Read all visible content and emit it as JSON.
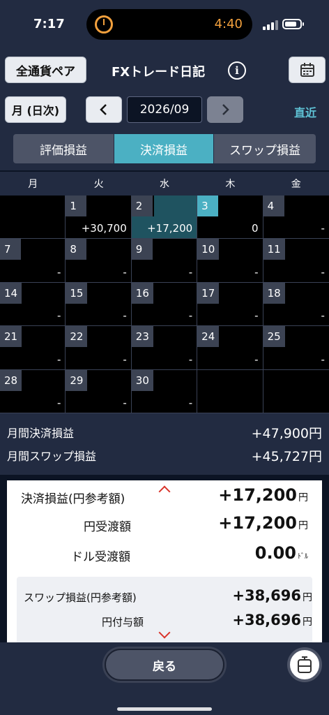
{
  "status_bar": {
    "time": "7:17",
    "timer": "4:40"
  },
  "header": {
    "pair_button": "全通貨ペア",
    "title": "FXトレード日記",
    "info_icon": "info-icon",
    "calendar_icon": "calendar-icon"
  },
  "date_nav": {
    "mode_button": "月 (日次)",
    "prev": "‹",
    "current": "2026/09",
    "next": "›",
    "recent": "直近"
  },
  "tabs": [
    {
      "label": "評価損益",
      "active": false
    },
    {
      "label": "決済損益",
      "active": true
    },
    {
      "label": "スワップ損益",
      "active": false
    }
  ],
  "calendar": {
    "weekdays": [
      "月",
      "火",
      "水",
      "木",
      "金"
    ],
    "cells": [
      {
        "day": "",
        "value": ""
      },
      {
        "day": "1",
        "value": "+30,700"
      },
      {
        "day": "2",
        "value": "+17,200",
        "selected": true
      },
      {
        "day": "3",
        "value": "0",
        "today": true
      },
      {
        "day": "4",
        "value": "-"
      },
      {
        "day": "7",
        "value": "-"
      },
      {
        "day": "8",
        "value": "-"
      },
      {
        "day": "9",
        "value": "-"
      },
      {
        "day": "10",
        "value": "-"
      },
      {
        "day": "11",
        "value": "-"
      },
      {
        "day": "14",
        "value": "-"
      },
      {
        "day": "15",
        "value": "-"
      },
      {
        "day": "16",
        "value": "-"
      },
      {
        "day": "17",
        "value": "-"
      },
      {
        "day": "18",
        "value": "-"
      },
      {
        "day": "21",
        "value": "-"
      },
      {
        "day": "22",
        "value": "-"
      },
      {
        "day": "23",
        "value": "-"
      },
      {
        "day": "24",
        "value": "-"
      },
      {
        "day": "25",
        "value": "-"
      },
      {
        "day": "28",
        "value": "-"
      },
      {
        "day": "29",
        "value": "-"
      },
      {
        "day": "30",
        "value": "-"
      },
      {
        "day": "",
        "value": ""
      },
      {
        "day": "",
        "value": ""
      }
    ]
  },
  "totals": {
    "settled_label": "月間決済損益",
    "settled_value": "+47,900円",
    "swap_label": "月間スワップ損益",
    "swap_value": "+45,727円"
  },
  "detail": {
    "settled_label": "決済損益(円参考額)",
    "settled_value": "+17,200",
    "settled_unit": "円",
    "yen_label": "円受渡額",
    "yen_value": "+17,200",
    "yen_unit": "円",
    "dollar_label": "ドル受渡額",
    "dollar_value": "0.00",
    "dollar_unit": "ﾄﾞﾙ",
    "swap_label": "スワップ損益(円参考額)",
    "swap_value": "+38,696",
    "swap_unit": "円",
    "yen_grant_label": "円付与額",
    "yen_grant_value": "+38,696",
    "yen_grant_unit": "円"
  },
  "bottom": {
    "back_button": "戻る"
  },
  "colors": {
    "accent": "#4bb0c3",
    "background": "#0c1424",
    "bar": "#222b41",
    "chevron": "#d9342b"
  }
}
